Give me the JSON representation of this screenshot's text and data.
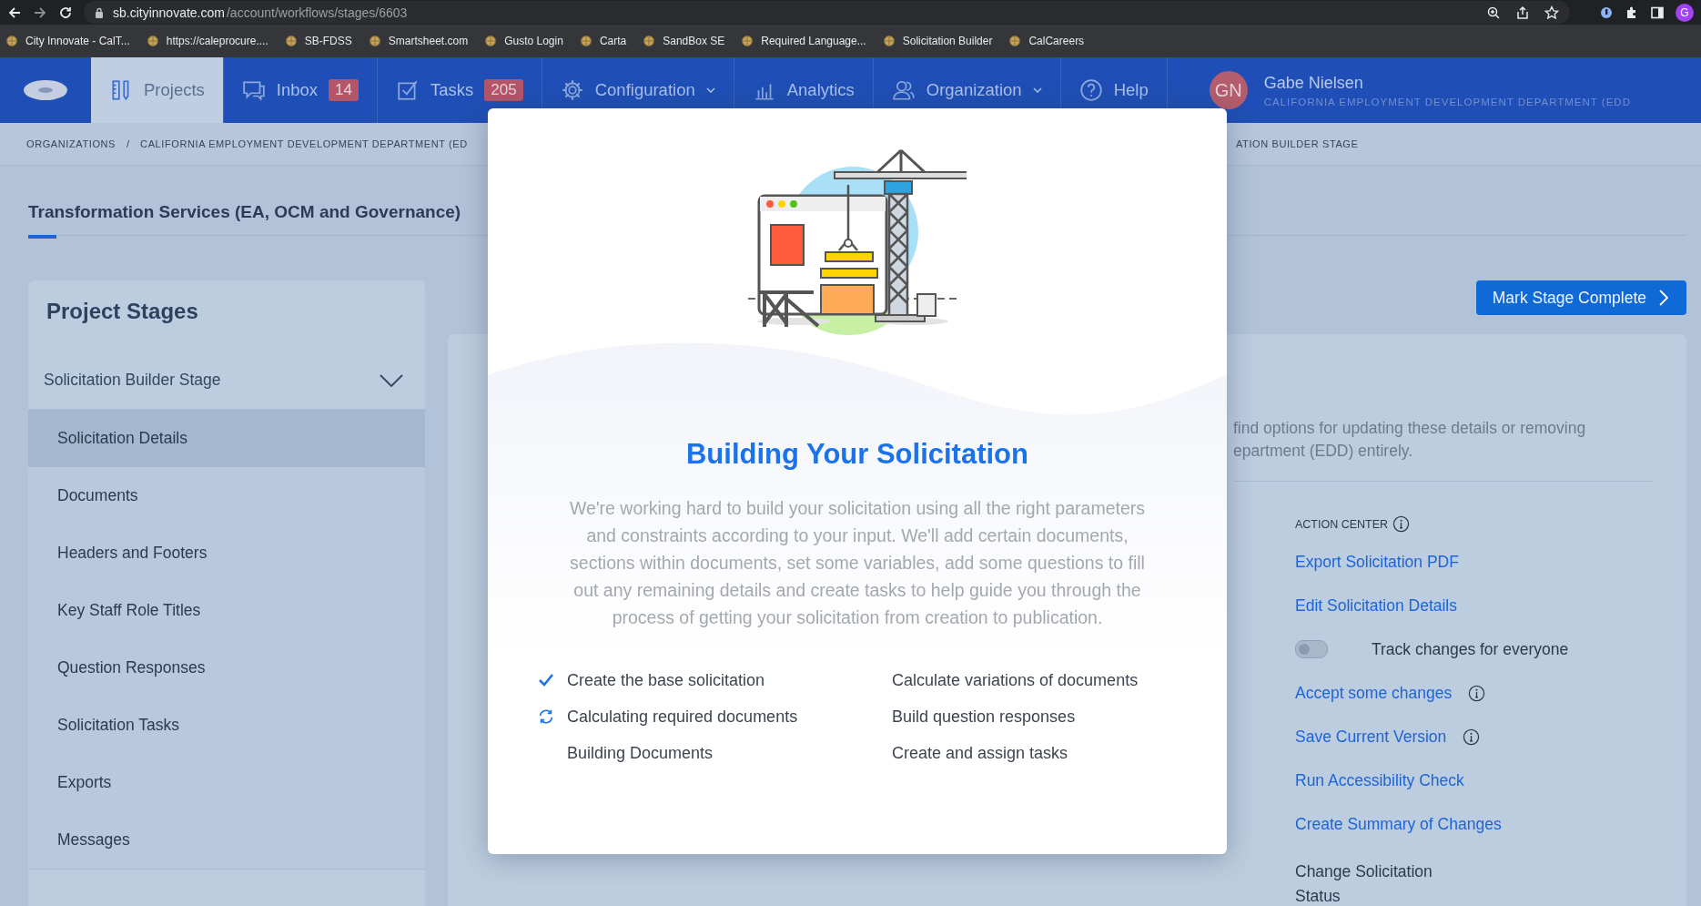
{
  "browser": {
    "url_host": "sb.cityinnovate.com",
    "url_path": "/account/workflows/stages/6603",
    "profile_initial": "G",
    "bookmarks": [
      {
        "label": "City Innovate - CalT..."
      },
      {
        "label": "https://caleprocure...."
      },
      {
        "label": "SB-FDSS"
      },
      {
        "label": "Smartsheet.com"
      },
      {
        "label": "Gusto Login"
      },
      {
        "label": "Carta"
      },
      {
        "label": "SandBox SE"
      },
      {
        "label": "Required Language..."
      },
      {
        "label": "Solicitation Builder"
      },
      {
        "label": "CalCareers"
      }
    ]
  },
  "nav": {
    "tabs": [
      {
        "label": "Projects",
        "selected": true
      },
      {
        "label": "Inbox",
        "badge": "14",
        "selected": false
      },
      {
        "label": "Tasks",
        "badge": "205",
        "selected": false
      },
      {
        "label": "Configuration",
        "dropdown": true,
        "selected": false
      },
      {
        "label": "Analytics",
        "selected": false
      },
      {
        "label": "Organization",
        "dropdown": true,
        "selected": false
      },
      {
        "label": "Help",
        "selected": false
      }
    ],
    "user": {
      "initials": "GN",
      "name": "Gabe Nielsen",
      "org": "CALIFORNIA EMPLOYMENT DEVELOPMENT DEPARTMENT (EDD"
    }
  },
  "breadcrumb": {
    "items": [
      "ORGANIZATIONS",
      "CALIFORNIA EMPLOYMENT DEVELOPMENT DEPARTMENT (ED"
    ],
    "separator": "/",
    "tail": "ATION BUILDER STAGE"
  },
  "page": {
    "title": "Transformation Services (EA, OCM and Governance)",
    "mark_button": "Mark Stage Complete"
  },
  "sidebar": {
    "title": "Project Stages",
    "group": {
      "label": "Solicitation Builder Stage",
      "expanded": true
    },
    "items": [
      {
        "label": "Solicitation Details",
        "selected": true
      },
      {
        "label": "Documents",
        "selected": false
      },
      {
        "label": "Headers and Footers",
        "selected": false
      },
      {
        "label": "Key Staff Role Titles",
        "selected": false
      },
      {
        "label": "Question Responses",
        "selected": false
      },
      {
        "label": "Solicitation Tasks",
        "selected": false
      },
      {
        "label": "Exports",
        "selected": false
      },
      {
        "label": "Messages",
        "selected": false
      }
    ]
  },
  "details": {
    "lines": [
      "find options for updating these details or removing",
      "epartment (EDD) entirely."
    ]
  },
  "action_center": {
    "title": "ACTION CENTER",
    "actions": [
      {
        "kind": "link",
        "label": "Export Solicitation PDF",
        "info": false
      },
      {
        "kind": "link",
        "label": "Edit Solicitation Details",
        "info": false
      },
      {
        "kind": "toggle",
        "label": "Track changes for everyone",
        "on": false
      },
      {
        "kind": "link",
        "label": "Accept some changes",
        "info": true
      },
      {
        "kind": "link",
        "label": "Save Current Version",
        "info": true
      },
      {
        "kind": "link",
        "label": "Run Accessibility Check",
        "info": false
      },
      {
        "kind": "link",
        "label": "Create Summary of Changes",
        "info": false
      },
      {
        "kind": "text",
        "label": "Change Solicitation Status"
      }
    ]
  },
  "modal": {
    "title": "Building Your Solicitation",
    "description": "We're working hard to build your solicitation using all the right parameters and constraints according to your input. We'll add certain documents, sections within documents, set some variables, add some questions to fill out any remaining details and create tasks to help guide you through the process of getting your solicitation from creation to publication.",
    "steps": [
      {
        "label": "Create the base solicitation",
        "done": true,
        "active": false
      },
      {
        "label": "Calculating required documents",
        "done": false,
        "active": true
      },
      {
        "label": "Building Documents",
        "done": false,
        "active": false
      },
      {
        "label": "Calculate variations of documents",
        "done": false,
        "active": false
      },
      {
        "label": "Build question responses",
        "done": false,
        "active": false
      },
      {
        "label": "Create and assign tasks",
        "done": false,
        "active": false
      }
    ]
  }
}
